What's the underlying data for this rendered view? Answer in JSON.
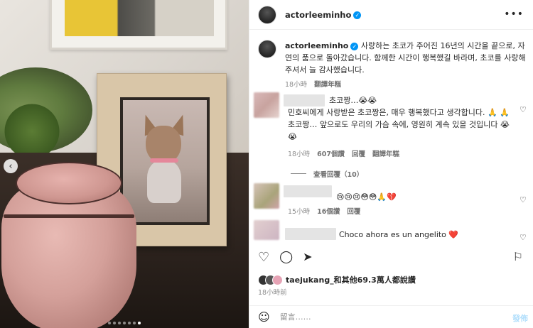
{
  "post": {
    "username": "actorleeminho",
    "caption": "사랑하는 초코가 주어진 16년의 시간을 끝으로, 자연의 품으로 돌아갔습니다. 함께한 시간이 행복했길 바라며, 초코를 사랑해주셔서 늘 감사했습니다.",
    "caption_time": "18小時",
    "caption_translate": "翻譯年糕",
    "likes_text": "taejukang_和其他69.3萬人都說讚",
    "time_text": "18小時前",
    "carousel": {
      "count": 7,
      "active": 7
    }
  },
  "comments": [
    {
      "text_lines": [
        "초코짱…😭😭",
        "민호씨에게 사랑받은 초코짱은, 매우 행복했다고 생각합니다. 🙏 🙏",
        "초코짱… 앞으로도 우리의 가슴 속에, 영원히 계속 있을 것입니다 😭",
        "😭"
      ],
      "time": "18小時",
      "likes": "607個讚",
      "reply": "回覆",
      "translate": "翻譯年糕",
      "view_replies": "查看回覆（10）"
    },
    {
      "text": "😢😢😢😳😳🙏💔",
      "time": "15小時",
      "likes": "16個讚",
      "reply": "回覆"
    },
    {
      "text": "Choco ahora es un angelito ❤️"
    }
  ],
  "compose": {
    "placeholder": "留言……",
    "post_label": "發佈"
  },
  "icons": {
    "more": "more-icon",
    "heart": "heart-icon",
    "comment": "comment-icon",
    "share": "share-icon",
    "bookmark": "bookmark-icon",
    "emoji": "emoji-icon",
    "verified": "verified-icon",
    "prev": "chevron-left-icon"
  },
  "colors": {
    "verified": "#0095f6",
    "post_button": "#b2dffc"
  }
}
